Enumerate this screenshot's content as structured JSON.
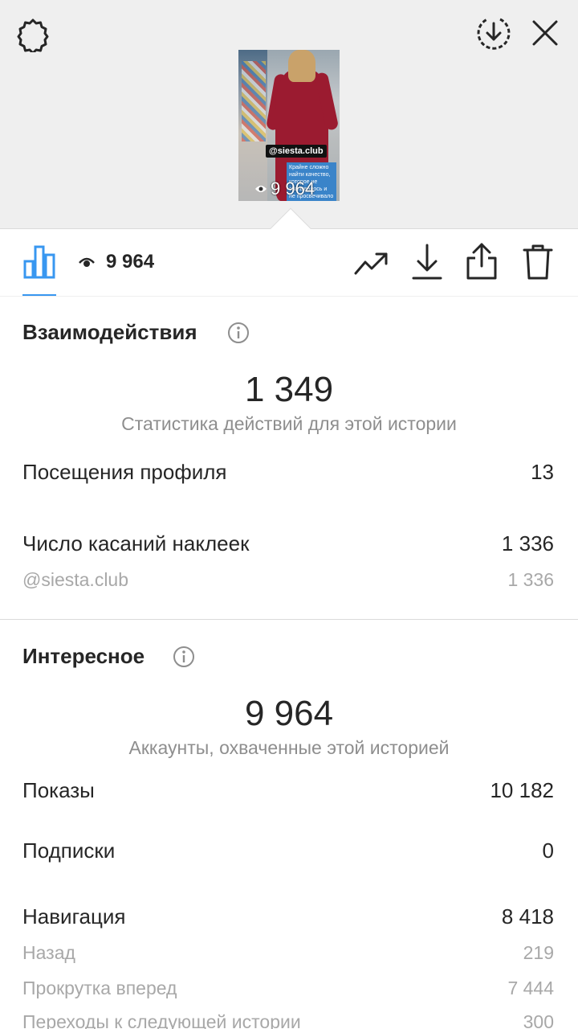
{
  "top": {
    "icons": [
      "gear-icon",
      "download-circle-icon",
      "close-icon"
    ],
    "thumbnail": {
      "tag_text": "@siesta.club",
      "caption_text": "Крайне сложно найти качество, которое не скатывалось и не просвечивало",
      "views": "9 964"
    }
  },
  "toolbar": {
    "views": "9 964",
    "icons": [
      "bar-chart-icon",
      "eye-icon",
      "trending-icon",
      "download-icon",
      "share-icon",
      "trash-icon"
    ],
    "active_color": "#3897f0"
  },
  "interactions": {
    "title": "Взаимодействия",
    "total": "1 349",
    "subtitle": "Статистика действий для этой истории",
    "rows": [
      {
        "label": "Посещения профиля",
        "value": "13"
      },
      {
        "label": "Число касаний наклеек",
        "value": "1 336"
      }
    ],
    "sub_rows": [
      {
        "label": "@siesta.club",
        "value": "1 336"
      }
    ]
  },
  "discovery": {
    "title": "Интересное",
    "total": "9 964",
    "subtitle": "Аккаунты, охваченные этой историей",
    "rows": [
      {
        "label": "Показы",
        "value": "10 182"
      },
      {
        "label": "Подписки",
        "value": "0"
      },
      {
        "label": "Навигация",
        "value": "8 418"
      }
    ],
    "sub_rows": [
      {
        "label": "Назад",
        "value": "219"
      },
      {
        "label": "Прокрутка вперед",
        "value": "7 444"
      },
      {
        "label": "Переходы к следующей истории",
        "value": "300"
      }
    ]
  }
}
